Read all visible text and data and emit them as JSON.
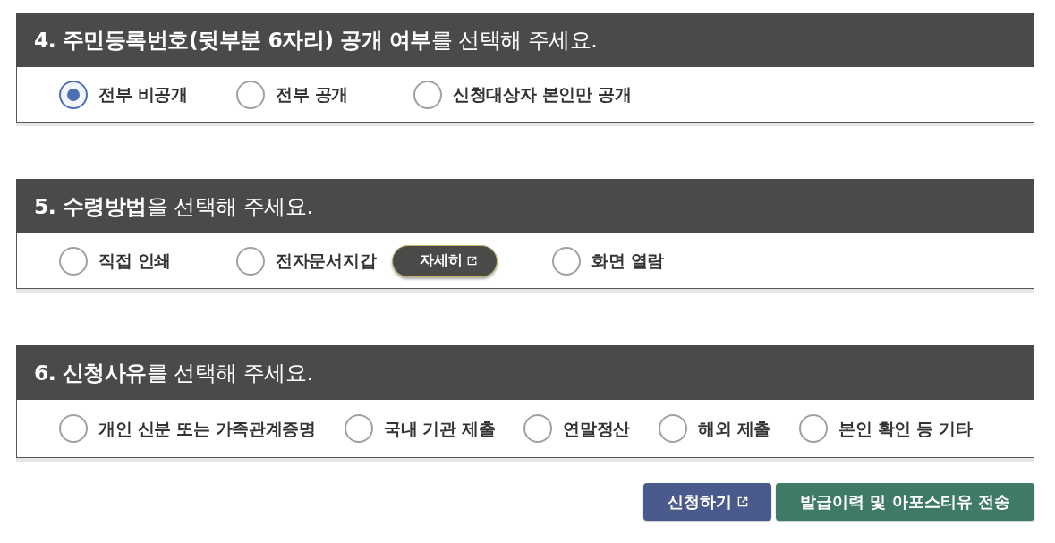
{
  "sections": [
    {
      "title": "**4. 주민등록번호(뒷부분 6자리) 공개 여부**를 선택해 주세요.",
      "options": [
        {
          "label": "전부 비공개",
          "selected": true
        },
        {
          "label": "전부 공개",
          "selected": false
        },
        {
          "label": "신청대상자 본인만 공개",
          "selected": false
        }
      ]
    },
    {
      "title": "**5. 수령방법**을 선택해 주세요.",
      "options": [
        {
          "label": "직접 인쇄",
          "selected": false
        },
        {
          "label": "전자문서지갑",
          "selected": false,
          "detail_button": {
            "label": "자세히"
          }
        },
        {
          "label": "화면 열람",
          "selected": false
        }
      ]
    },
    {
      "title": "**6. 신청사유**를 선택해 주세요.",
      "options": [
        {
          "label": "개인 신분 또는 가족관계증명",
          "selected": false
        },
        {
          "label": "국내 기관 제출",
          "selected": false
        },
        {
          "label": "연말정산",
          "selected": false
        },
        {
          "label": "해외 제출",
          "selected": false
        },
        {
          "label": "본인 확인 등 기타",
          "selected": false
        }
      ]
    }
  ],
  "buttons": [
    {
      "label": "신청하기",
      "color": "#4b5a8c",
      "external": true
    },
    {
      "label": "발급이력 및 아포스티유 전송",
      "color": "#3f7a69",
      "external": false
    }
  ]
}
